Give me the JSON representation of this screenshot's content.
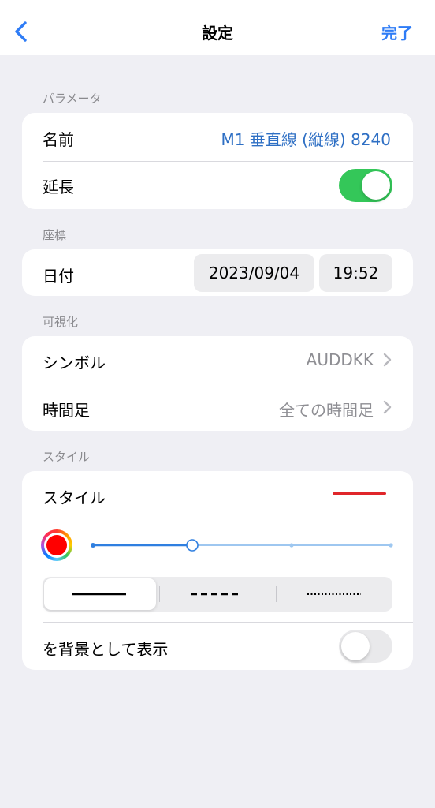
{
  "nav": {
    "title": "設定",
    "done_label": "完了",
    "back_icon": "chevron-left-icon"
  },
  "sections": {
    "parameters": {
      "header": "パラメータ",
      "name_label": "名前",
      "name_value": "M1 垂直線 (縦線) 8240",
      "extend_label": "延長",
      "extend_on": true
    },
    "coordinates": {
      "header": "座標",
      "date_label": "日付",
      "date_value": "2023/09/04",
      "time_value": "19:52"
    },
    "visualization": {
      "header": "可視化",
      "symbol_label": "シンボル",
      "symbol_value": "AUDDKK",
      "timeframe_label": "時間足",
      "timeframe_value": "全ての時間足"
    },
    "style": {
      "header": "スタイル",
      "style_label": "スタイル",
      "line_color": "#e0262a",
      "selected_color": "#ff0000",
      "thickness_level": 2,
      "thickness_levels": 4,
      "line_styles": [
        "solid",
        "dashed",
        "dotted"
      ],
      "selected_line_style": "solid",
      "background_label": "を背景として表示",
      "background_on": false
    }
  },
  "colors": {
    "accent": "#2e7cf6",
    "toggle_on": "#34c759",
    "slider": "#2f7fe0",
    "slider_track": "#9ec7f0"
  }
}
